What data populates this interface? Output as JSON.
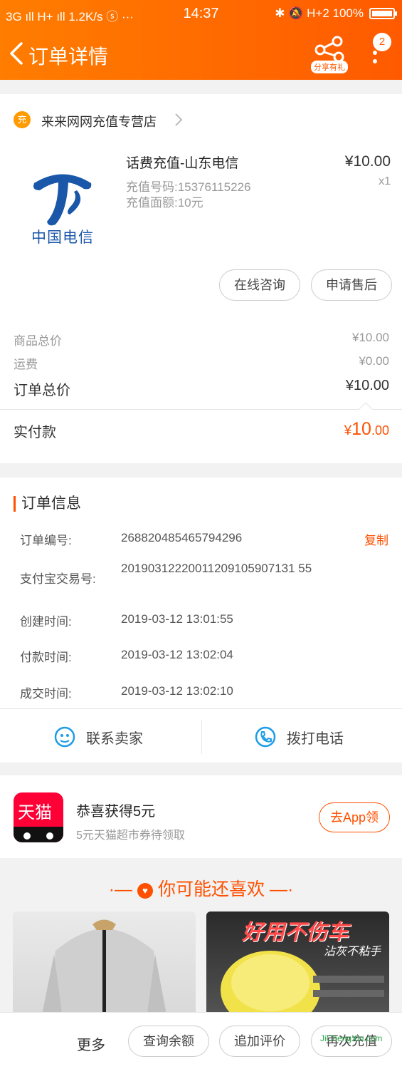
{
  "status_bar": {
    "left": "3G ıll H+ ıll 1.2K/s ⓢ ···",
    "time": "14:37",
    "right": "✱ 🔕 H+2 100%"
  },
  "header": {
    "title": "订单详情",
    "share_label": "分享有礼",
    "badge_count": "2"
  },
  "store": {
    "icon_char": "充",
    "name": "来来网网充值专营店"
  },
  "product": {
    "logo_text": "中国电信",
    "name": "话费充值-山东电信",
    "recharge_number": "充值号码:15376115226",
    "recharge_amount": "充值面额:10元",
    "price": "¥10.00",
    "qty": "x1"
  },
  "actions": {
    "consult": "在线咨询",
    "after_sale": "申请售后"
  },
  "summary": {
    "goods_label": "商品总价",
    "goods_val": "¥10.00",
    "shipping_label": "运费",
    "shipping_val": "¥0.00",
    "total_label": "订单总价",
    "total_val": "¥10.00",
    "paid_label": "实付款",
    "paid_currency": "¥",
    "paid_int": "10",
    "paid_dec": ".00"
  },
  "order_info": {
    "title": "订单信息",
    "copy_label": "复制",
    "rows": [
      {
        "label": "订单编号:",
        "value": "268820485465794296"
      },
      {
        "label": "支付宝交易号:",
        "value": "20190312220011209105907131 55"
      },
      {
        "label": "创建时间:",
        "value": "2019-03-12 13:01:55"
      },
      {
        "label": "付款时间:",
        "value": "2019-03-12 13:02:04"
      },
      {
        "label": "成交时间:",
        "value": "2019-03-12 13:02:10"
      }
    ],
    "contact_seller": "联系卖家",
    "call_phone": "拨打电话"
  },
  "coupon": {
    "logo_text": "天猫",
    "title": "恭喜获得5元",
    "subtitle": "5元天猫超市券待领取",
    "button": "去App领"
  },
  "recommend": {
    "title": "你可能还喜欢",
    "item2_caption": "好用不伤车",
    "item2_caption2": "沾灰不粘手"
  },
  "bottom_bar": {
    "more": "更多",
    "balance": "查询余额",
    "review": "追加评价",
    "recharge_again": "再次充值"
  },
  "watermark": "JiChengXin.com",
  "colors": {
    "accent": "#ff5000",
    "header_gradient_start": "#ff7d00",
    "header_gradient_end": "#ff5a00",
    "telecom_blue": "#1a57a8",
    "tmall_red": "#ff0036"
  }
}
